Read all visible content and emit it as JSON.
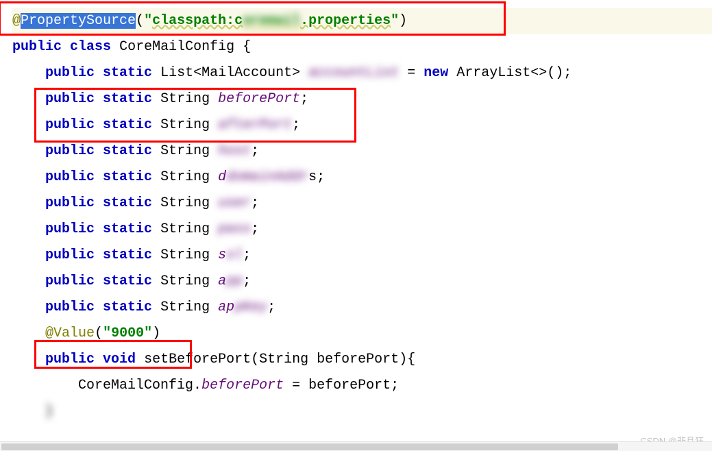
{
  "code": {
    "line1": {
      "at": "@",
      "annotation": "PropertySource",
      "paren_open": "(",
      "quote_open": "\"",
      "string_prefix": "classpath:c",
      "string_blurred": "oremail",
      "string_suffix": ".properties",
      "quote_close": "\"",
      "paren_close": ")"
    },
    "line2": {
      "public": "public",
      "class": "class",
      "name": "CoreMailConfig",
      "brace": "{"
    },
    "line3": {
      "public": "public",
      "static": "static",
      "type": "List<MailAccount>",
      "name_blur": "accountList",
      "equals": "=",
      "new": "new",
      "ctor": "ArrayList<>()",
      "semi": ";"
    },
    "line4": {
      "public": "public",
      "static": "static",
      "type": "String",
      "name": "beforePort",
      "semi": ";"
    },
    "line5": {
      "public": "public",
      "static": "static",
      "type": "String",
      "name_blur": "afterPort",
      "semi": ";"
    },
    "line6": {
      "public": "public",
      "static": "static",
      "type": "String",
      "name_blur": "host",
      "semi": ";"
    },
    "line7": {
      "public": "public",
      "static": "static",
      "type": "String",
      "name_blur": "domainAddr",
      "char": "d",
      "semi_char": "s;"
    },
    "line8": {
      "public": "public",
      "static": "static",
      "type": "String",
      "name_blur": "user",
      "semi": ";"
    },
    "line9": {
      "public": "public",
      "static": "static",
      "type": "String",
      "name_blur": "pass",
      "semi": ";"
    },
    "line10": {
      "public": "public",
      "static": "static",
      "type": "String",
      "char": "s",
      "name_blur": "sl",
      "semi": ";"
    },
    "line11": {
      "public": "public",
      "static": "static",
      "type": "String",
      "char": "a",
      "name_blur": "pp",
      "semi": ";"
    },
    "line12": {
      "public": "public",
      "static": "static",
      "type": "String",
      "char": "ap",
      "name_blur": "pKey",
      "semi": ";"
    },
    "line13": {
      "at": "@",
      "annotation": "Value",
      "paren_open": "(",
      "quote_open": "\"",
      "value": "9000",
      "quote_close": "\"",
      "paren_close": ")"
    },
    "line14": {
      "public": "public",
      "void": "void",
      "method": "setBeforePort",
      "paren_open": "(",
      "param_type": "String",
      "param_name": "beforePort",
      "paren_close": ")",
      "brace": "{"
    },
    "line15": {
      "class_ref": "CoreMailConfig",
      "dot": ".",
      "field": "beforePort",
      "equals": " = ",
      "param": "beforePort",
      "semi": ";"
    },
    "line16": {
      "brace": "}"
    }
  },
  "watermark": "CSDN @悲且狂"
}
